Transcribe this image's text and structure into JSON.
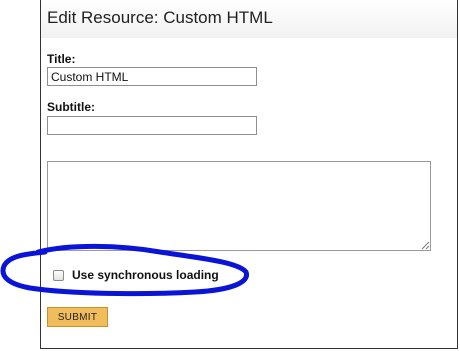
{
  "header": {
    "title": "Edit Resource: Custom HTML"
  },
  "form": {
    "title_label": "Title:",
    "title_value": "Custom HTML",
    "subtitle_label": "Subtitle:",
    "subtitle_value": "",
    "content_value": "",
    "sync_checkbox_label": "Use synchronous loading",
    "sync_checkbox_checked": false,
    "submit_label": "SUBMIT"
  },
  "annotation": {
    "color": "#0a14d6"
  },
  "colors": {
    "submit_bg": "#f1bd5c",
    "panel_border": "#333333"
  }
}
